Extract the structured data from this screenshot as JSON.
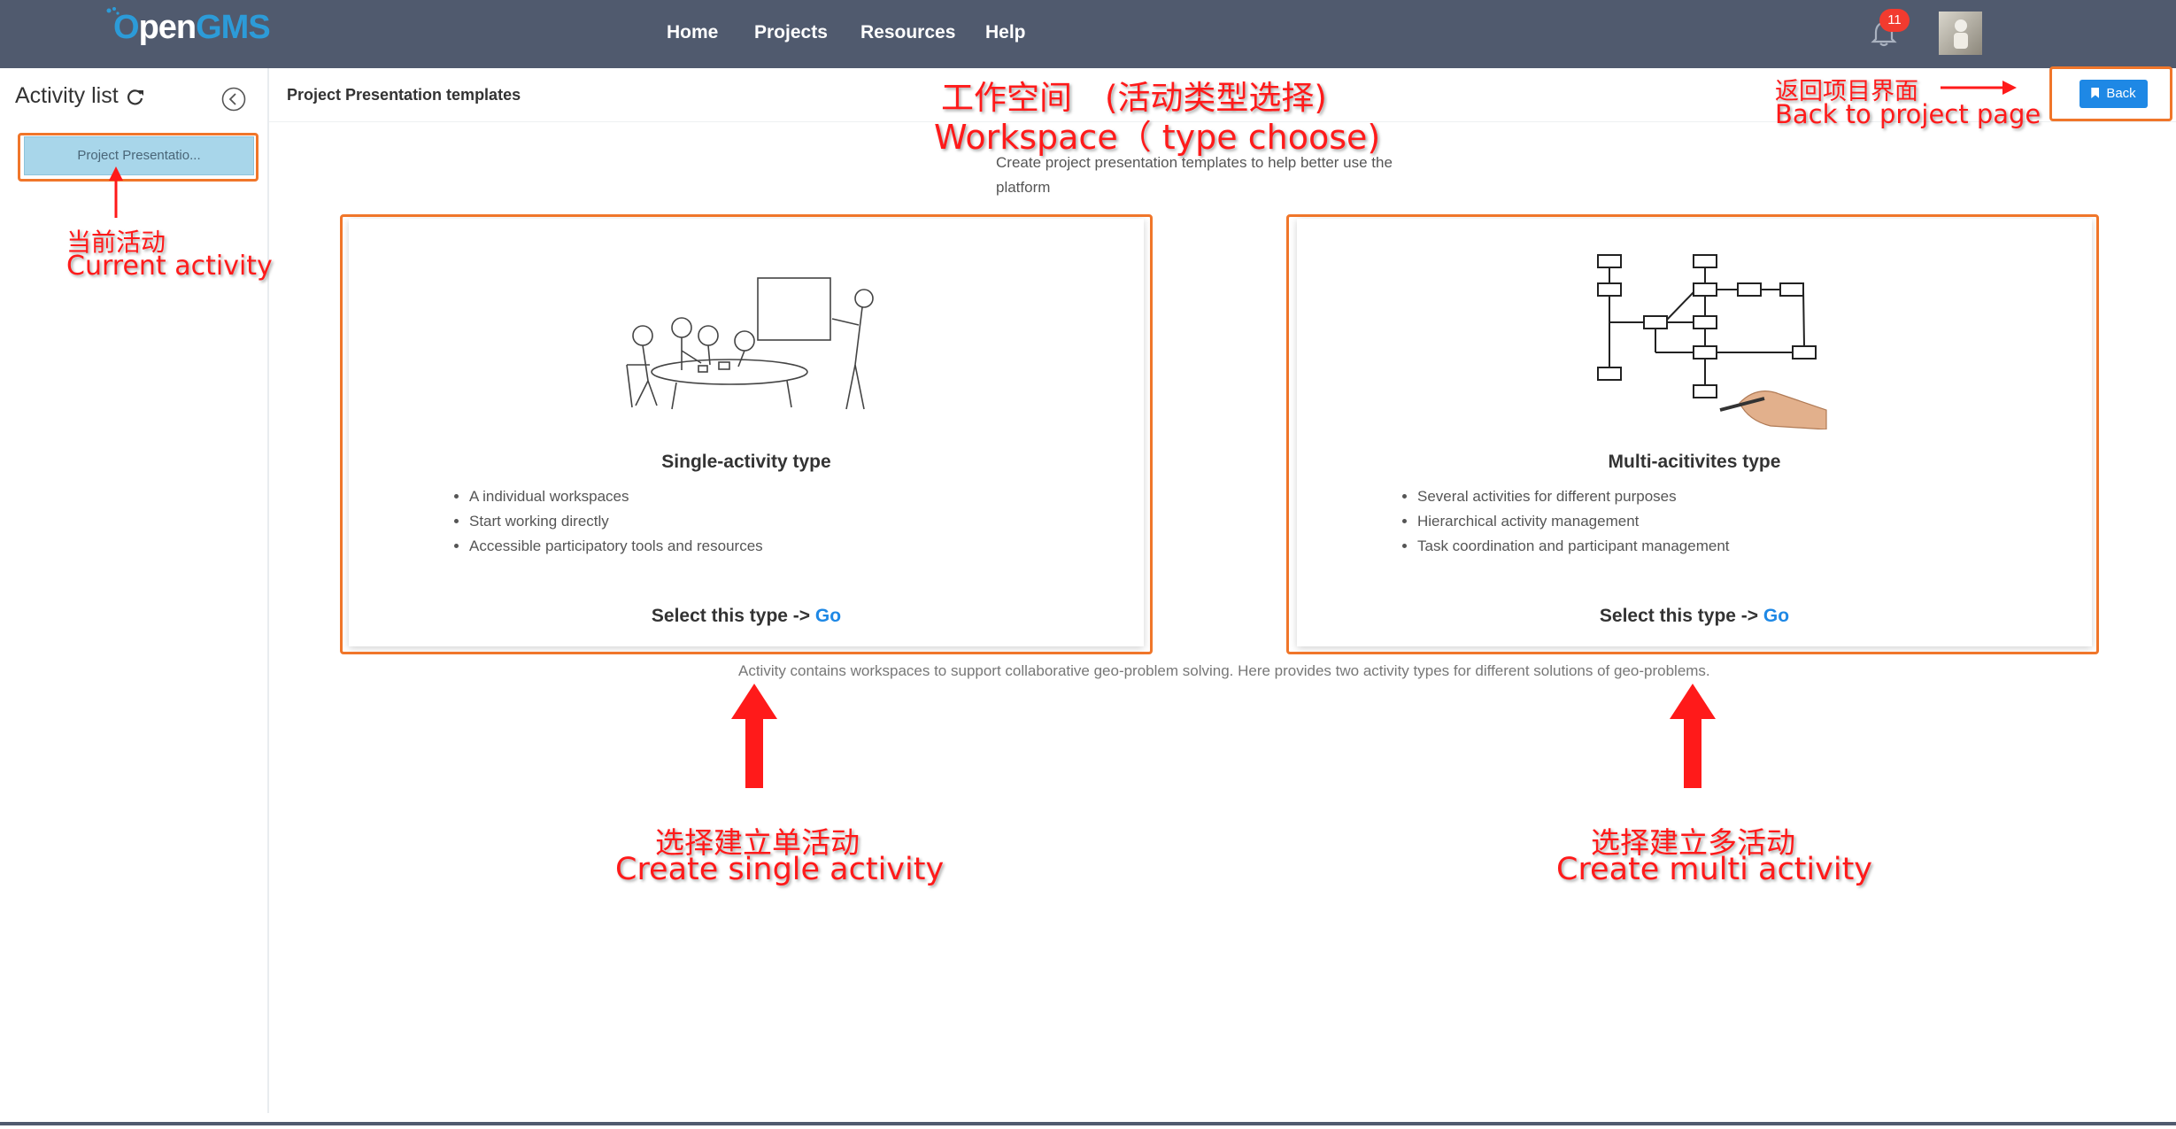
{
  "header": {
    "logo": {
      "part_o": "O",
      "part_pen": "pen",
      "part_gms": "GMS"
    },
    "nav": [
      "Home",
      "Projects",
      "Resources",
      "Help"
    ],
    "notification_count": "11",
    "bell_icon": "bell-icon",
    "avatar_icon": "user-avatar"
  },
  "sidebar": {
    "title": "Activity list",
    "refresh_icon": "refresh-icon",
    "collapse_icon": "chevron-left-circle-icon",
    "items": [
      {
        "label": "Project Presentatio..."
      }
    ]
  },
  "main": {
    "title": "Project Presentation templates",
    "back_label": "Back",
    "description": "Create project presentation templates to help better use the platform",
    "cards": [
      {
        "title": "Single-activity type",
        "features": [
          "A individual workspaces",
          "Start working directly",
          "Accessible participatory tools and resources"
        ],
        "select_text": "Select this type ->",
        "go_label": "Go",
        "illustration_icon": "meeting-illustration"
      },
      {
        "title": "Multi-acitivites type",
        "features": [
          "Several activities for different purposes",
          "Hierarchical activity management",
          "Task coordination and participant management"
        ],
        "select_text": "Select this type ->",
        "go_label": "Go",
        "illustration_icon": "flowchart-illustration"
      }
    ],
    "note": "Activity contains workspaces to support collaborative geo-problem solving. Here provides two activity types for different solutions of geo-problems."
  },
  "annotations": {
    "workspace_cn": "工作空间　(活动类型选择)",
    "workspace_en": "Workspace（ type choose)",
    "back_cn": "返回项目界面",
    "back_en": "Back to project page",
    "current_cn": "当前活动",
    "current_en": "Current activity",
    "single_cn": "选择建立单活动",
    "single_en": "Create single activity",
    "multi_cn": "选择建立多活动",
    "multi_en": "Create multi activity",
    "accent_color": "#ff1a1a",
    "box_color": "#f0762a"
  }
}
